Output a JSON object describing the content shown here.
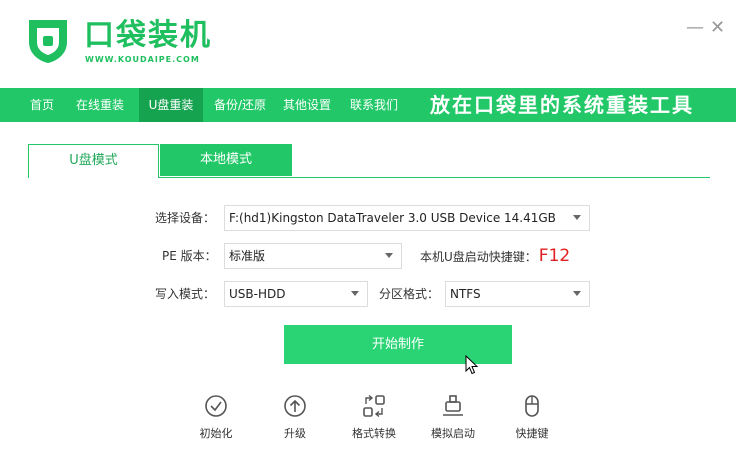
{
  "app": {
    "brand_title": "口袋装机",
    "brand_url": "WWW.KOUDAIPE.COM",
    "slogan": "放在口袋里的系统重装工具",
    "accent_color": "#22c868"
  },
  "window_controls": {
    "minimize": "—",
    "close": "✕"
  },
  "nav": {
    "items": [
      {
        "label": "首页"
      },
      {
        "label": "在线重装"
      },
      {
        "label": "U盘重装",
        "active": true
      },
      {
        "label": "备份/还原"
      },
      {
        "label": "其他设置"
      },
      {
        "label": "联系我们"
      }
    ]
  },
  "tabs": [
    {
      "label": "U盘模式",
      "active": true
    },
    {
      "label": "本地模式",
      "active": false
    }
  ],
  "form": {
    "device_label": "选择设备：",
    "device_value": "F:(hd1)Kingston DataTraveler 3.0 USB Device 14.41GB",
    "pe_label": "PE 版本：",
    "pe_value": "标准版",
    "hotkey_label": "本机U盘启动快捷键：",
    "hotkey_value": "F12",
    "write_mode_label": "写入模式：",
    "write_mode_value": "USB-HDD",
    "partition_label": "分区格式：",
    "partition_value": "NTFS"
  },
  "start_button": {
    "label": "开始制作"
  },
  "tools": [
    {
      "label": "初始化",
      "icon": "check-circle-icon"
    },
    {
      "label": "升级",
      "icon": "arrow-up-circle-icon"
    },
    {
      "label": "格式转换",
      "icon": "convert-icon"
    },
    {
      "label": "模拟启动",
      "icon": "usb-stick-icon"
    },
    {
      "label": "快捷键",
      "icon": "mouse-icon"
    }
  ]
}
